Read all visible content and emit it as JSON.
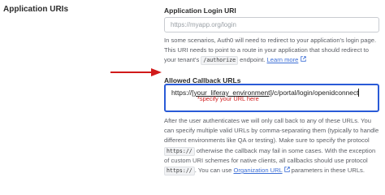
{
  "section": {
    "title": "Application URIs"
  },
  "login_uri": {
    "label": "Application Login URI",
    "placeholder": "https://myapp.org/login",
    "help_before": "In some scenarios, Auth0 will need to redirect to your application's login page. This URI needs to point to a route in your application that should redirect to your tenant's ",
    "help_code": "/authorize",
    "help_after": " endpoint. ",
    "learn_more": "Learn more"
  },
  "callback_urls": {
    "label": "Allowed Callback URLs",
    "value_prefix": "https://",
    "value_variable": "[your_liferay_environment]",
    "value_suffix": "/c/portal/login/openidconnect",
    "annotation": "*specify your URL here",
    "help_part1": "After the user authenticates we will only call back to any of these URLs. You can specify multiple valid URLs by comma-separating them (typically to handle different environments like QA or testing). Make sure to specify the protocol ",
    "help_code1": "https://",
    "help_part2": " otherwise the callback may fail in some cases. With the exception of custom URI schemes for native clients, all callbacks should use protocol ",
    "help_code2": "https://",
    "help_part3": ". You can use ",
    "org_url_link": "Organization URL",
    "help_part4": " parameters in these URLs."
  },
  "colors": {
    "accent": "#2a5bd7",
    "link": "#3d6fd6",
    "annotation_red": "#d11a1a"
  },
  "icons": [
    "external-link-icon",
    "red-arrow-icon"
  ]
}
